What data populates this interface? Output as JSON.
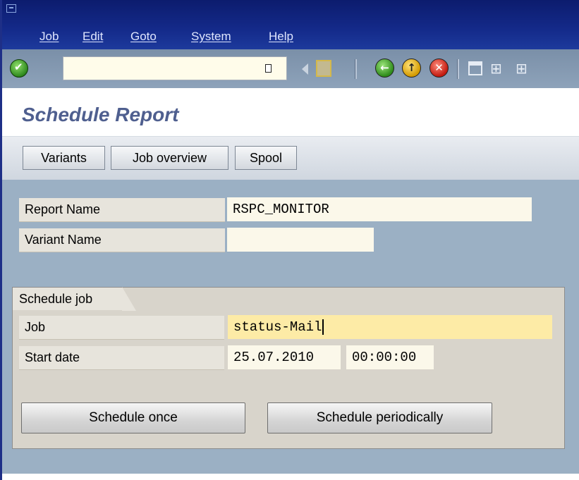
{
  "menu": {
    "items": [
      "Job",
      "Edit",
      "Goto",
      "System",
      "Help"
    ]
  },
  "toolbar": {
    "command_field_value": "",
    "icons": [
      "enter-icon",
      "command-field-dropdown-icon",
      "back-triangle-icon",
      "save-icon",
      "back-icon",
      "exit-icon",
      "cancel-icon",
      "print-icon",
      "find-icon",
      "find-next-icon"
    ]
  },
  "title": "Schedule Report",
  "app_toolbar": {
    "variants": "Variants",
    "job_overview": "Job overview",
    "spool": "Spool"
  },
  "report": {
    "report_name_label": "Report Name",
    "report_name_value": "RSPC_MONITOR",
    "variant_name_label": "Variant Name",
    "variant_name_value": ""
  },
  "schedule": {
    "tab_label": "Schedule job",
    "job_label": "Job",
    "job_value": "status-Mail",
    "start_date_label": "Start date",
    "start_date_value": "25.07.2010",
    "start_time_value": "00:00:00",
    "schedule_once": "Schedule once",
    "schedule_periodically": "Schedule periodically"
  },
  "colors": {
    "menubar": "#142a8a",
    "content_bg": "#9bb0c4",
    "title": "#4f5f8f",
    "focus_field": "#fdeba6"
  }
}
